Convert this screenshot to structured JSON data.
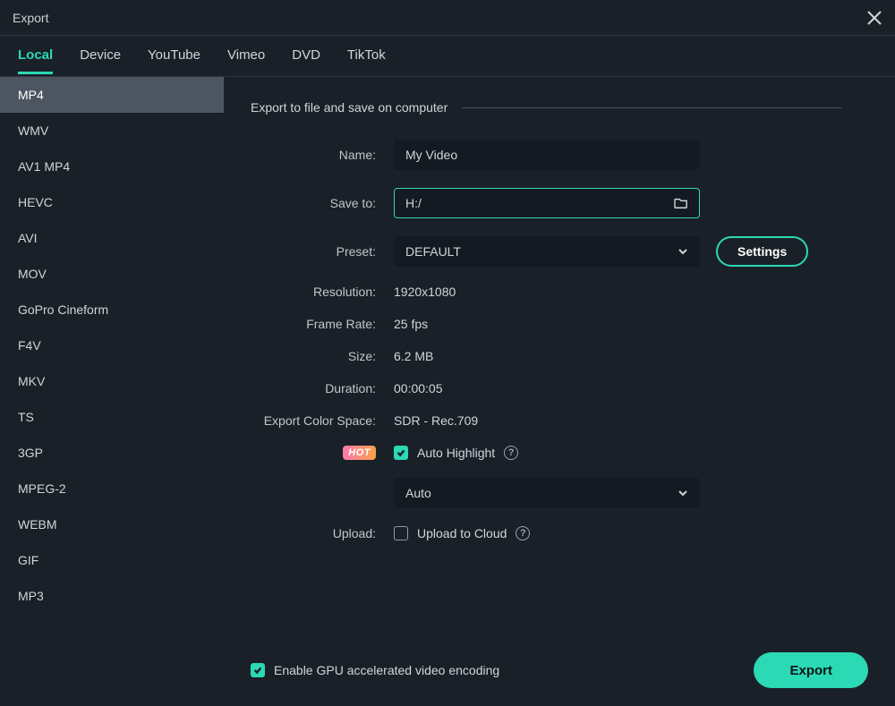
{
  "window": {
    "title": "Export"
  },
  "tabs": [
    "Local",
    "Device",
    "YouTube",
    "Vimeo",
    "DVD",
    "TikTok"
  ],
  "activeTab": "Local",
  "formats": [
    "MP4",
    "WMV",
    "AV1 MP4",
    "HEVC",
    "AVI",
    "MOV",
    "GoPro Cineform",
    "F4V",
    "MKV",
    "TS",
    "3GP",
    "MPEG-2",
    "WEBM",
    "GIF",
    "MP3"
  ],
  "activeFormat": "MP4",
  "section": {
    "heading": "Export to file and save on computer"
  },
  "labels": {
    "name": "Name:",
    "saveTo": "Save to:",
    "preset": "Preset:",
    "resolution": "Resolution:",
    "frameRate": "Frame Rate:",
    "size": "Size:",
    "duration": "Duration:",
    "colorSpace": "Export Color Space:",
    "upload": "Upload:",
    "settingsBtn": "Settings",
    "hotBadge": "HOT",
    "autoHighlight": "Auto Highlight",
    "autoSelect": "Auto",
    "uploadCloud": "Upload to Cloud",
    "gpu": "Enable GPU accelerated video encoding",
    "exportBtn": "Export"
  },
  "values": {
    "name": "My Video",
    "saveTo": "H:/",
    "preset": "DEFAULT",
    "resolution": "1920x1080",
    "frameRate": "25 fps",
    "size": "6.2 MB",
    "duration": "00:00:05",
    "colorSpace": "SDR - Rec.709"
  },
  "checks": {
    "autoHighlight": true,
    "uploadCloud": false,
    "gpu": true
  }
}
